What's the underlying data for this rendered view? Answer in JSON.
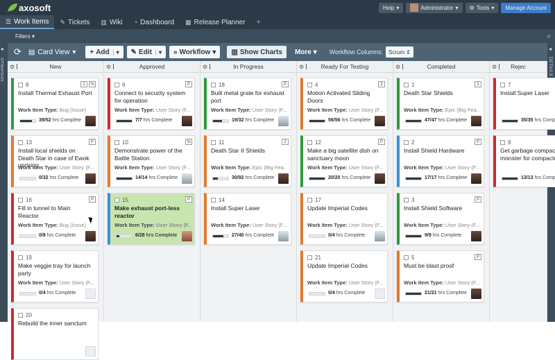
{
  "top": {
    "logo": "axosoft",
    "help": "Help",
    "user": "Administrator",
    "tools": "Tools",
    "manage": "Manage Account"
  },
  "nav": {
    "tabs": [
      {
        "label": "Work Items",
        "icon": "list-icon"
      },
      {
        "label": "Tickets",
        "icon": "ticket-icon"
      },
      {
        "label": "Wiki",
        "icon": "book-icon"
      },
      {
        "label": "Dashboard",
        "icon": "dashboard-icon"
      },
      {
        "label": "Release Planner",
        "icon": "calendar-icon"
      }
    ],
    "add": "+"
  },
  "filters": {
    "label": "Filters"
  },
  "toolbar": {
    "view": "Card View",
    "add": "Add",
    "edit": "Edit",
    "workflow": "Workflow",
    "charts": "Show Charts",
    "more": "More",
    "wf_label": "Workflow Columns:",
    "wf_value": "Scrum"
  },
  "side": {
    "left": "ORGANIZE",
    "right": "DETAILS"
  },
  "columns": [
    {
      "name": "New",
      "cards": [
        {
          "id": "8",
          "title": "Install Thermal Exhaust Port",
          "type": "Bug (Issue)",
          "progress": "39/52",
          "frac": 0.75,
          "color": "#2f9a3c",
          "avatar": "p1",
          "badges": [
            "2",
            "%"
          ]
        },
        {
          "id": "13",
          "title": "Install local shields on Death Star in case of Ewok uprising",
          "type": "User Story (F...",
          "progress": "0/32",
          "frac": 0,
          "color": "#e07a2e",
          "avatar": "p1",
          "badges": [
            "P"
          ]
        },
        {
          "id": "16",
          "title": "Fill in tunnel to Main Reactor",
          "type": "Bug (Issue)",
          "progress": "0/8",
          "frac": 0,
          "color": "#cc2a2a",
          "avatar": "p1",
          "badges": [
            "P"
          ]
        },
        {
          "id": "19",
          "title": "Make veggie tray for launch party",
          "type": "User Story (F...",
          "progress": "0/4",
          "frac": 0,
          "color": "#cc2a2a",
          "avatar": "none",
          "badges": []
        },
        {
          "id": "20",
          "title": "Rebuild the inner sanctum",
          "type": "",
          "progress": "",
          "frac": 0,
          "color": "#cc2a2a",
          "avatar": "none",
          "badges": []
        }
      ]
    },
    {
      "name": "Approved",
      "cards": [
        {
          "id": "6",
          "title": "Connect to security system for operation",
          "type": "User Story (F...",
          "progress": "7/7",
          "frac": 1,
          "color": "#cc2a2a",
          "avatar": "p1",
          "badges": [
            "P"
          ]
        },
        {
          "id": "10",
          "title": "Demonstrate power of the Battle Station",
          "type": "User Story (F...",
          "progress": "14/14",
          "frac": 1,
          "color": "#e07a2e",
          "avatar": "p2",
          "badges": [
            "%"
          ]
        },
        {
          "id": "15",
          "title": "Make exhaust port-less reactor",
          "type": "User Story (F...",
          "progress": "6/28",
          "frac": 0.2,
          "color": "#3a8fd6",
          "avatar": "p3",
          "badges": [
            "P"
          ],
          "selected": true
        }
      ]
    },
    {
      "name": "In Progress",
      "cards": [
        {
          "id": "18",
          "title": "Built metal grate for exhaust port",
          "type": "User Story (F...",
          "progress": "19/32",
          "frac": 0.6,
          "color": "#2f9a3c",
          "avatar": "p2",
          "badges": [
            "P"
          ]
        },
        {
          "id": "11",
          "title": "Death Star II Shields",
          "type": "Epic (Big Fea...",
          "progress": "30/92",
          "frac": 0.33,
          "color": "#e07a2e",
          "avatar": "p1",
          "badges": [
            "2"
          ]
        },
        {
          "id": "14",
          "title": "Install Super Laser",
          "type": "User Story (F...",
          "progress": "27/40",
          "frac": 0.68,
          "color": "#e07a2e",
          "avatar": "p2",
          "badges": []
        }
      ]
    },
    {
      "name": "Ready For Testing",
      "cards": [
        {
          "id": "4",
          "title": "Motion Activated Sliding Doors",
          "type": "User Story (F...",
          "progress": "56/56",
          "frac": 1,
          "color": "#e07a2e",
          "avatar": "p1",
          "badges": [
            "2"
          ]
        },
        {
          "id": "12",
          "title": "Make a big satellite dish on sanctuary moon",
          "type": "User Story (F...",
          "progress": "20/20",
          "frac": 1,
          "color": "#2f9a3c",
          "avatar": "p1",
          "badges": [
            "P"
          ]
        },
        {
          "id": "17",
          "title": "Update Imperial Codes",
          "type": "User Story (F...",
          "progress": "0/4",
          "frac": 0,
          "color": "#e07a2e",
          "avatar": "p2",
          "badges": []
        },
        {
          "id": "21",
          "title": "Update Imperial Codes",
          "type": "User Story (F...",
          "progress": "0/4",
          "frac": 0,
          "color": "#e07a2e",
          "avatar": "none",
          "badges": []
        }
      ]
    },
    {
      "name": "Completed",
      "cards": [
        {
          "id": "1",
          "title": "Death Star Shields",
          "type": "Epic (Big Fea...",
          "progress": "47/47",
          "frac": 1,
          "color": "#2f9a3c",
          "avatar": "p1",
          "badges": [
            "2"
          ]
        },
        {
          "id": "2",
          "title": "Install Shield Hardware",
          "type": "User Story (F...",
          "progress": "17/17",
          "frac": 1,
          "color": "#3a8fd6",
          "avatar": "p1",
          "badges": [
            "P"
          ]
        },
        {
          "id": "3",
          "title": "Install Shield Software",
          "type": "User Story (F...",
          "progress": "9/9",
          "frac": 1,
          "color": "#2f9a3c",
          "avatar": "p1",
          "badges": [
            "P"
          ]
        },
        {
          "id": "5",
          "title": "Must be blast proof",
          "type": "User Story (F...",
          "progress": "21/21",
          "frac": 1,
          "color": "#e07a2e",
          "avatar": "p1",
          "badges": [
            "P"
          ]
        }
      ]
    },
    {
      "name": "Rejec",
      "cards": [
        {
          "id": "7",
          "title": "Install Super Laser",
          "type": "",
          "progress": "35/35",
          "frac": 1,
          "color": "#cc2a2a",
          "avatar": "none",
          "badges": []
        },
        {
          "id": "9",
          "title": "Get garbage compactor monster for compactor",
          "type": "",
          "progress": "13/13",
          "frac": 1,
          "color": "#cc2a2a",
          "avatar": "none",
          "badges": []
        }
      ]
    }
  ],
  "labels": {
    "wit": "Work Item Type:",
    "hrs": "hrs Complete"
  }
}
